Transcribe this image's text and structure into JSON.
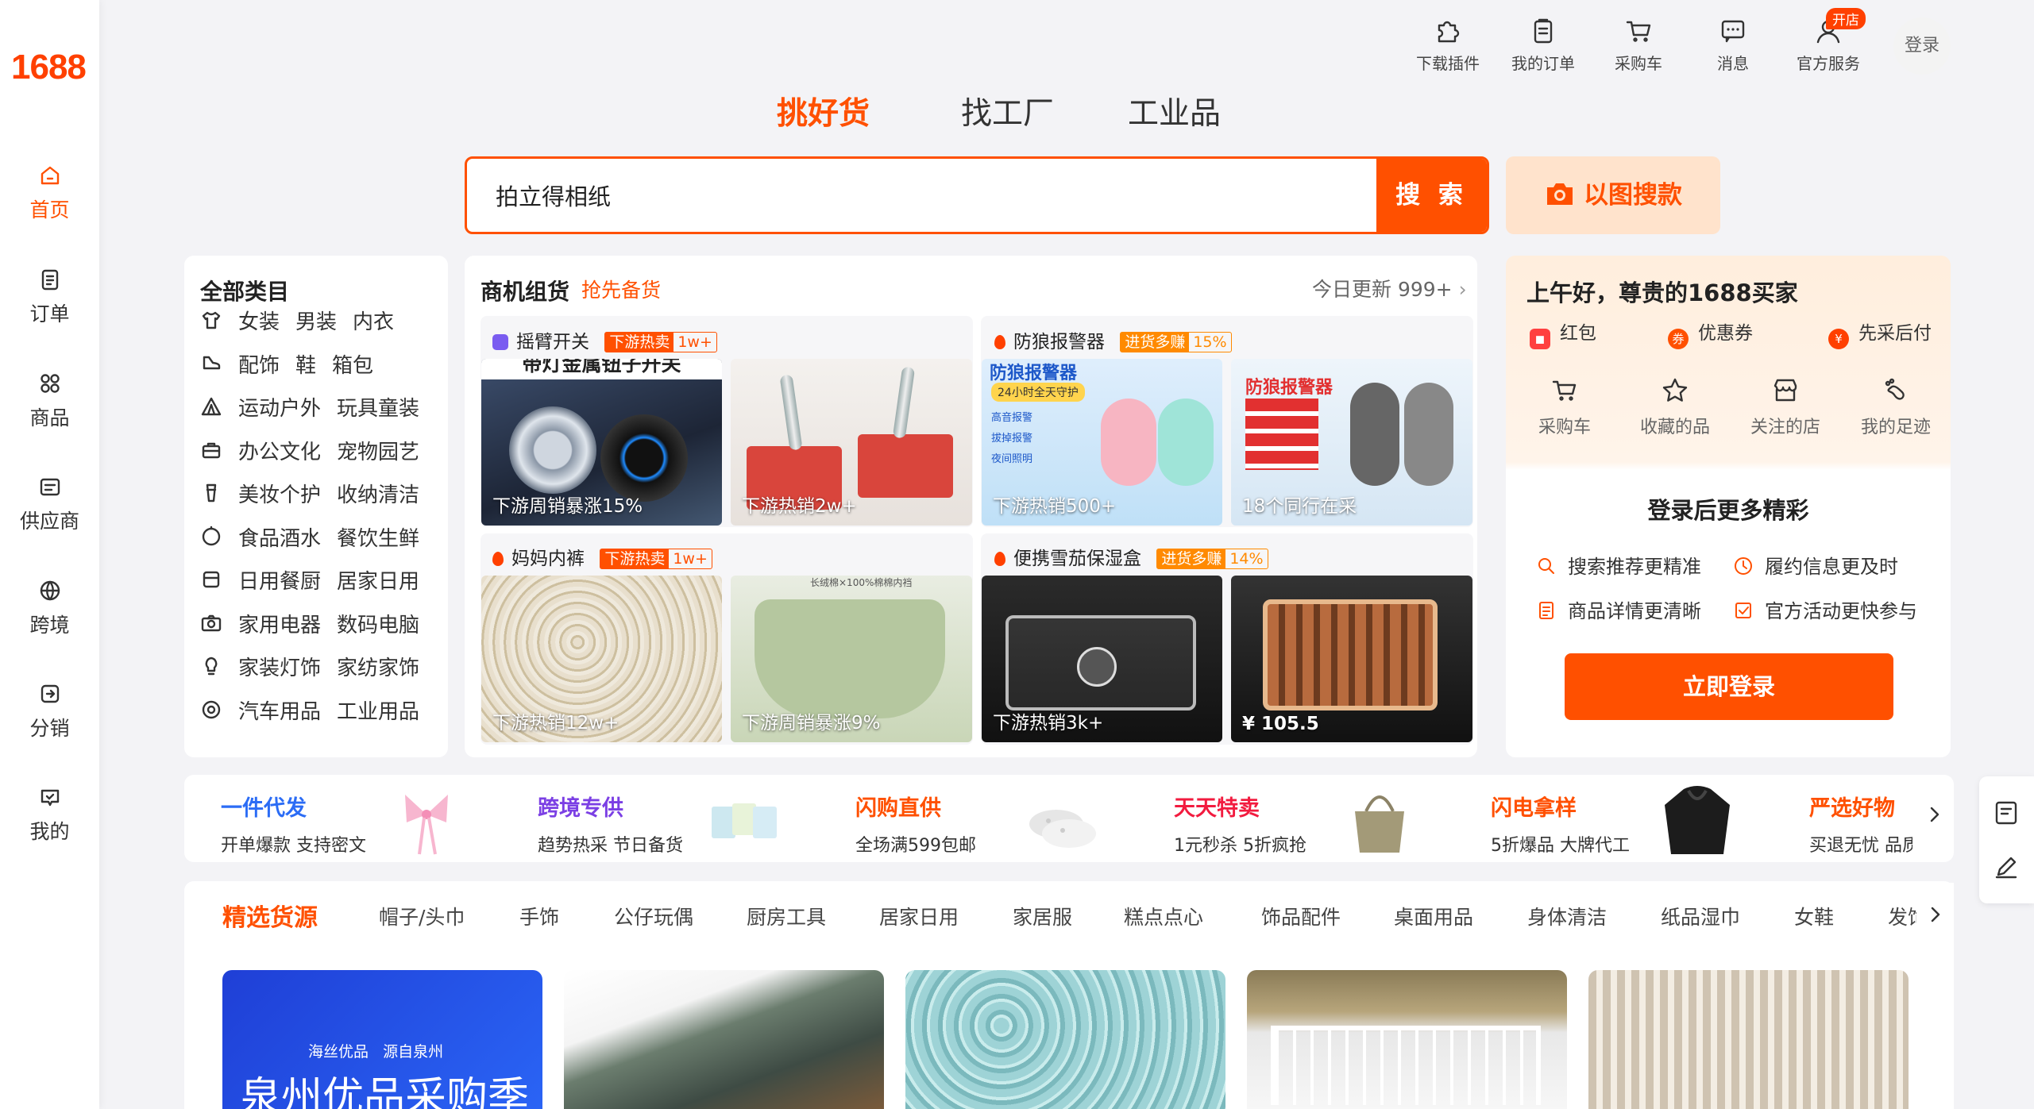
{
  "brand": {
    "logo": "1688",
    "accent": "#ff5000"
  },
  "sidebar": {
    "items": [
      {
        "label": "首页",
        "icon": "home-icon",
        "active": true
      },
      {
        "label": "订单",
        "icon": "order-icon"
      },
      {
        "label": "商品",
        "icon": "grid-icon"
      },
      {
        "label": "供应商",
        "icon": "supplier-icon"
      },
      {
        "label": "跨境",
        "icon": "globe-icon"
      },
      {
        "label": "分销",
        "icon": "distribution-icon"
      },
      {
        "label": "我的",
        "icon": "heart-chat-icon"
      }
    ]
  },
  "topnav": {
    "items": [
      {
        "label": "下载插件",
        "icon": "puzzle-icon"
      },
      {
        "label": "我的订单",
        "icon": "clipboard-icon"
      },
      {
        "label": "采购车",
        "icon": "cart-icon"
      },
      {
        "label": "消息",
        "icon": "message-icon"
      },
      {
        "label": "官方服务",
        "icon": "service-icon"
      }
    ],
    "open_store_badge": "开店",
    "login": "登录"
  },
  "search": {
    "tabs": [
      "挑好货",
      "找工厂",
      "工业品"
    ],
    "active_tab": "挑好货",
    "value": "拍立得相纸",
    "button": "搜 索",
    "image_search": "以图搜款"
  },
  "categories": {
    "title": "全部类目",
    "rows": [
      {
        "icon": "shirt-icon",
        "items": [
          "女装",
          "男装",
          "内衣"
        ]
      },
      {
        "icon": "shoe-icon",
        "items": [
          "配饰",
          "鞋",
          "箱包"
        ]
      },
      {
        "icon": "tent-icon",
        "items": [
          "运动户外",
          "玩具童装"
        ]
      },
      {
        "icon": "briefcase-icon",
        "items": [
          "办公文化",
          "宠物园艺"
        ]
      },
      {
        "icon": "cosmetics-icon",
        "items": [
          "美妆个护",
          "收纳清洁"
        ]
      },
      {
        "icon": "food-icon",
        "items": [
          "食品酒水",
          "餐饮生鲜"
        ]
      },
      {
        "icon": "home-goods-icon",
        "items": [
          "日用餐厨",
          "居家日用"
        ]
      },
      {
        "icon": "camera-icon",
        "items": [
          "家用电器",
          "数码电脑"
        ]
      },
      {
        "icon": "lamp-icon",
        "items": [
          "家装灯饰",
          "家纺家饰"
        ]
      },
      {
        "icon": "wheel-icon",
        "items": [
          "汽车用品",
          "工业用品"
        ]
      }
    ]
  },
  "deals": {
    "title": "商机组货",
    "subtitle": "抢先备货",
    "update": "今日更新 999+",
    "groups": [
      {
        "name": "摇臂开关",
        "badge_label": "下游热卖",
        "badge_value": "1w+",
        "badge_style": "red",
        "items": [
          {
            "caption": "下游周销暴涨15%",
            "kind": "metal-switch"
          },
          {
            "caption": "下游热销2w+",
            "kind": "toggle-switch"
          }
        ]
      },
      {
        "name": "防狼报警器",
        "badge_label": "进货多赚",
        "badge_value": "15%",
        "badge_style": "orange",
        "items": [
          {
            "caption": "下游热销500+",
            "kind": "alarm-pink"
          },
          {
            "caption": "18个同行在采",
            "kind": "alarm-grey"
          }
        ]
      },
      {
        "name": "妈妈内裤",
        "badge_label": "下游热卖",
        "badge_value": "1w+",
        "badge_style": "red",
        "items": [
          {
            "caption": "下游热销12w+",
            "kind": "floral"
          },
          {
            "caption": "下游周销暴涨9%",
            "kind": "green-fabric"
          }
        ]
      },
      {
        "name": "便携雪茄保湿盒",
        "badge_label": "进货多赚",
        "badge_value": "14%",
        "badge_style": "orange",
        "items": [
          {
            "caption": "下游热销3k+",
            "kind": "cigar-case"
          },
          {
            "caption": "¥ 105.5",
            "kind": "cigar-box"
          }
        ]
      }
    ],
    "image_texts": {
      "switch_banner": "带灯金属钮子开关",
      "alarm_banner": "防狼报警器",
      "alarm_guard": "24小时全天守护",
      "alarm_features": [
        "高音报警",
        "拔掉报警",
        "夜间照明"
      ],
      "alarm2_title": "防狼报警器",
      "fabric_label": "长绒棉×100%棉棉内裆"
    }
  },
  "user": {
    "greeting": "上午好，尊贵的1688买家",
    "perks": [
      {
        "label": "红包",
        "color": "#ff4040"
      },
      {
        "label": "优惠券",
        "color": "#ff5000",
        "glyph": "券"
      },
      {
        "label": "先采后付",
        "color": "#ff4000",
        "glyph": "¥"
      }
    ],
    "quick": [
      {
        "label": "采购车",
        "icon": "cart-icon"
      },
      {
        "label": "收藏的品",
        "icon": "star-icon"
      },
      {
        "label": "关注的店",
        "icon": "store-icon"
      },
      {
        "label": "我的足迹",
        "icon": "footprint-icon"
      }
    ],
    "more_title": "登录后更多精彩",
    "benefits": [
      {
        "label": "搜索推荐更精准",
        "icon": "search-icon"
      },
      {
        "label": "履约信息更及时",
        "icon": "clock-icon"
      },
      {
        "label": "商品详情更清晰",
        "icon": "doc-icon"
      },
      {
        "label": "官方活动更快参与",
        "icon": "check-icon"
      }
    ],
    "login_button": "立即登录"
  },
  "channels": [
    {
      "title": "一件代发",
      "desc": "开单爆款 支持密文",
      "color": "#2b6cf5",
      "image": "bow-ribbon"
    },
    {
      "title": "跨境专供",
      "desc": "趋势热采 节日备货",
      "color": "#7b3fe4",
      "image": "soap-packs"
    },
    {
      "title": "闪购直供",
      "desc": "全场满599包邮",
      "color": "#ff5000",
      "image": "clogs"
    },
    {
      "title": "天天特卖",
      "desc": "1元秒杀 5折疯抢",
      "color": "#f21b3f",
      "image": "handbag"
    },
    {
      "title": "闪电拿样",
      "desc": "5折爆品 大牌代工",
      "color": "#ff5000",
      "image": "hoodie"
    },
    {
      "title": "严选好物",
      "desc": "买退无忧 品质",
      "color": "#ff5000",
      "image": ""
    }
  ],
  "cat_tabs": {
    "active": "精选货源",
    "items": [
      "帽子/头巾",
      "手饰",
      "公仔玩偶",
      "厨房工具",
      "居家日用",
      "家居服",
      "糕点点心",
      "饰品配件",
      "桌面用品",
      "身体清洁",
      "纸品湿巾",
      "女鞋",
      "发饰"
    ]
  },
  "products": [
    {
      "kind": "banner",
      "small": "海丝优品   源自泉州",
      "big": "泉州优品采购季"
    },
    {
      "kind": "jeans"
    },
    {
      "kind": "jade-beads"
    },
    {
      "kind": "container-house"
    },
    {
      "kind": "jewelry-display"
    }
  ]
}
